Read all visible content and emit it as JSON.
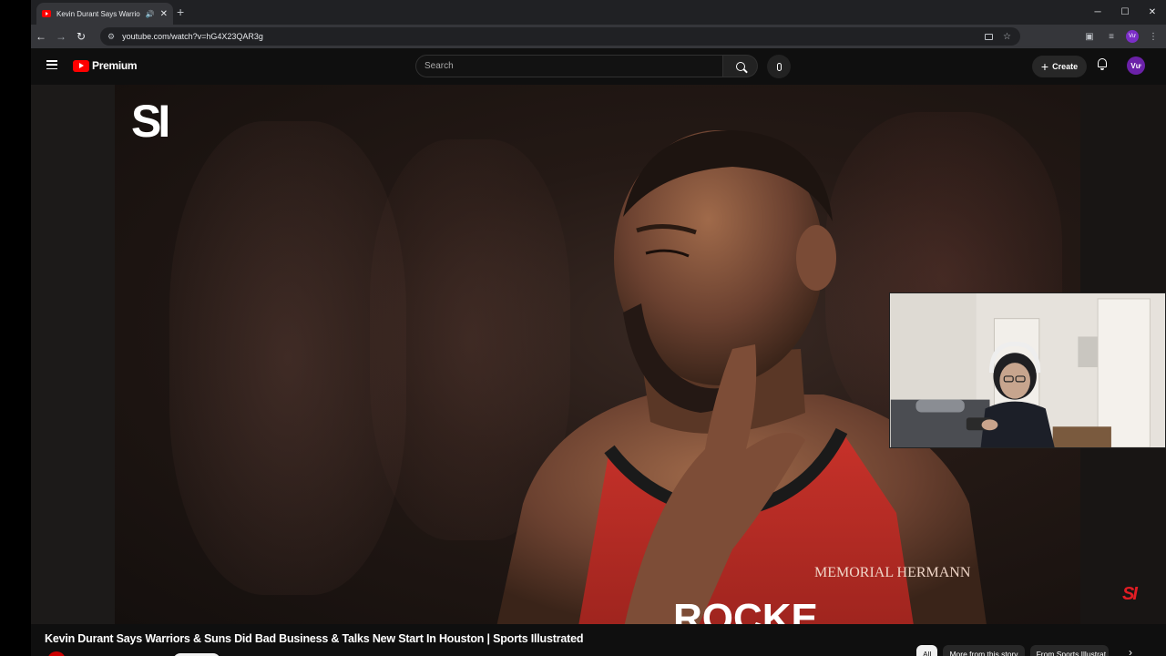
{
  "browser": {
    "tab_title": "Kevin Durant Says Warriors",
    "new_tab": "+",
    "url": "youtube.com/watch?v=hG4X23QAR3g",
    "profile_initials": "Vư"
  },
  "youtube": {
    "logo_text": "Premium",
    "search_placeholder": "Search",
    "create_label": "Create",
    "avatar_initials": "Vư"
  },
  "video": {
    "brand_mark": "SI",
    "corner_mark": "SI",
    "jersey_text": "MEMORIAL HERMANN",
    "jersey_front": "ROCKE",
    "title": "Kevin Durant Says Warriors & Suns Did Bad Business & Talks New Start In Houston | Sports Illustrated"
  },
  "chips": [
    {
      "label": "All"
    },
    {
      "label": "More from this story"
    },
    {
      "label": "From Sports Illustrat"
    }
  ],
  "colors": {
    "youtube_red": "#ff0000",
    "jersey_red": "#c8322a",
    "si_red": "#e11d24"
  }
}
